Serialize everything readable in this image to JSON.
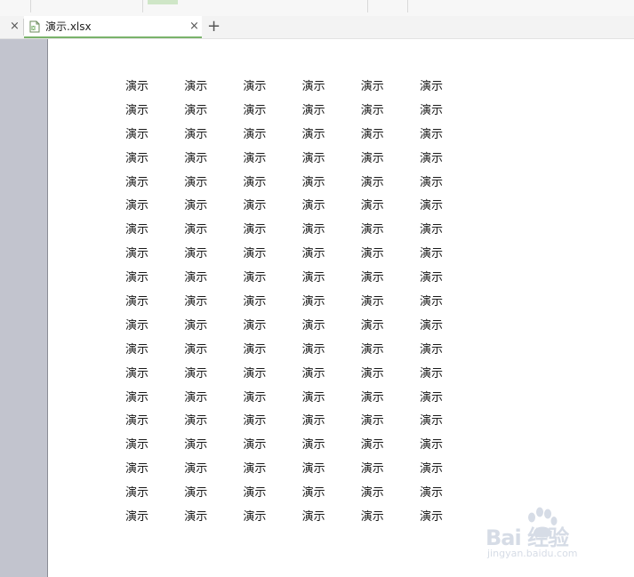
{
  "tabs": {
    "active": {
      "title": "演示.xlsx",
      "close_label": "×"
    },
    "previous_close_label": "×",
    "new_tab_label": "+"
  },
  "sheet": {
    "cell_text": "演示",
    "rows": [
      [
        "演示",
        "演示",
        "演示",
        "演示",
        "演示",
        "演示"
      ],
      [
        "演示",
        "演示",
        "演示",
        "演示",
        "演示",
        "演示"
      ],
      [
        "演示",
        "演示",
        "演示",
        "演示",
        "演示",
        "演示"
      ],
      [
        "演示",
        "演示",
        "演示",
        "演示",
        "演示",
        "演示"
      ],
      [
        "演示",
        "演示",
        "演示",
        "演示",
        "演示",
        "演示"
      ],
      [
        "演示",
        "演示",
        "演示",
        "演示",
        "演示",
        "演示"
      ],
      [
        "演示",
        "演示",
        "演示",
        "演示",
        "演示",
        "演示"
      ],
      [
        "演示",
        "演示",
        "演示",
        "演示",
        "演示",
        "演示"
      ],
      [
        "演示",
        "演示",
        "演示",
        "演示",
        "演示",
        "演示"
      ],
      [
        "演示",
        "演示",
        "演示",
        "演示",
        "演示",
        "演示"
      ],
      [
        "演示",
        "演示",
        "演示",
        "演示",
        "演示",
        "演示"
      ],
      [
        "演示",
        "演示",
        "演示",
        "演示",
        "演示",
        "演示"
      ],
      [
        "演示",
        "演示",
        "演示",
        "演示",
        "演示",
        "演示"
      ],
      [
        "演示",
        "演示",
        "演示",
        "演示",
        "演示",
        "演示"
      ],
      [
        "演示",
        "演示",
        "演示",
        "演示",
        "演示",
        "演示"
      ],
      [
        "演示",
        "演示",
        "演示",
        "演示",
        "演示",
        "演示"
      ],
      [
        "演示",
        "演示",
        "演示",
        "演示",
        "演示",
        "演示"
      ],
      [
        "演示",
        "演示",
        "演示",
        "演示",
        "演示",
        "演示"
      ],
      [
        "演示",
        "演示",
        "演示",
        "演示",
        "演示",
        "演示"
      ]
    ]
  },
  "watermark": {
    "brand_text": "Bai  经验",
    "url_text": "jingyan.baidu.com"
  },
  "colors": {
    "accent_green": "#7ab36b",
    "sidebar_gray": "#c2c4ce",
    "watermark": "#d6dce6"
  },
  "icons": {
    "file": "spreadsheet-file-icon",
    "close": "close-icon",
    "new_tab": "plus-icon",
    "watermark": "baidu-paw-icon"
  }
}
